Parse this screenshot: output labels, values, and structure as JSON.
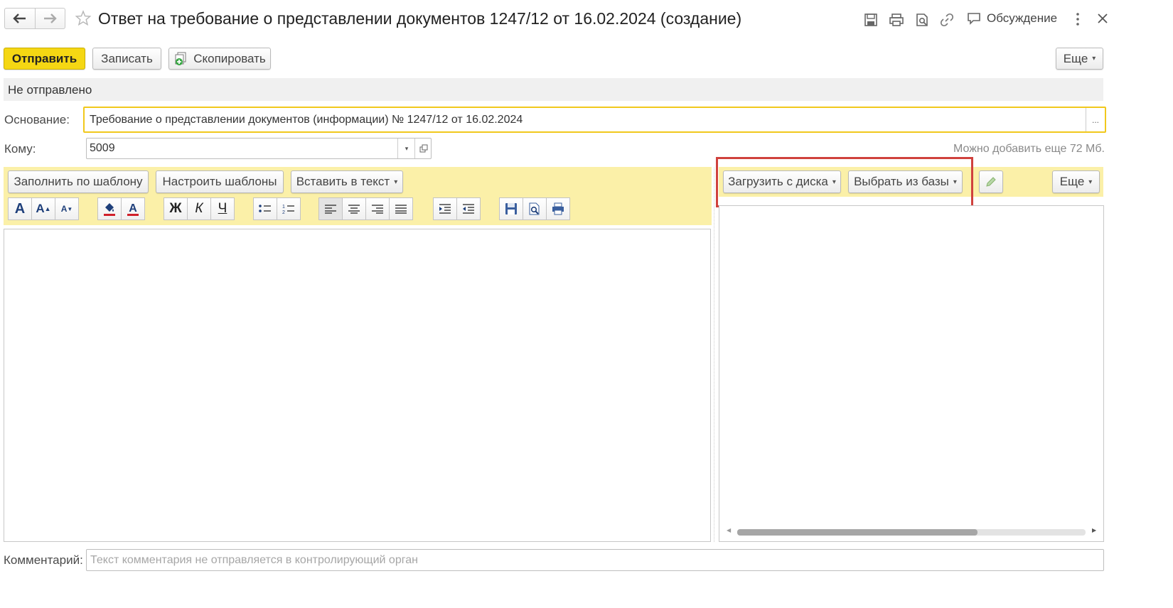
{
  "window": {
    "title": "Ответ на требование о представлении документов 1247/12 от 16.02.2024 (создание)",
    "discussion_label": "Обсуждение"
  },
  "toolbar": {
    "send_label": "Отправить",
    "save_label": "Записать",
    "copy_label": "Скопировать",
    "more_label": "Еще"
  },
  "status": {
    "text": "Не отправлено"
  },
  "basis": {
    "label": "Основание:",
    "value": "Требование о представлении документов (информации) № 1247/12 от 16.02.2024",
    "select_glyph": "..."
  },
  "to": {
    "label": "Кому:",
    "value": "5009"
  },
  "attachments": {
    "space_left": "Можно добавить еще 72 Мб.",
    "upload_label": "Загрузить с диска",
    "choose_label": "Выбрать из базы",
    "more_label": "Еще"
  },
  "editor": {
    "fill_template_label": "Заполнить по шаблону",
    "configure_templates_label": "Настроить шаблоны",
    "insert_text_label": "Вставить в текст",
    "bold_glyph": "Ж",
    "italic_glyph": "К",
    "underline_glyph": "Ч"
  },
  "comment": {
    "label": "Комментарий:",
    "placeholder": "Текст комментария не отправляется в контролирующий орган"
  },
  "colors": {
    "accent_yellow": "#f5d713",
    "panel_yellow": "#fbf0a8",
    "highlight_red": "#d0413d"
  }
}
